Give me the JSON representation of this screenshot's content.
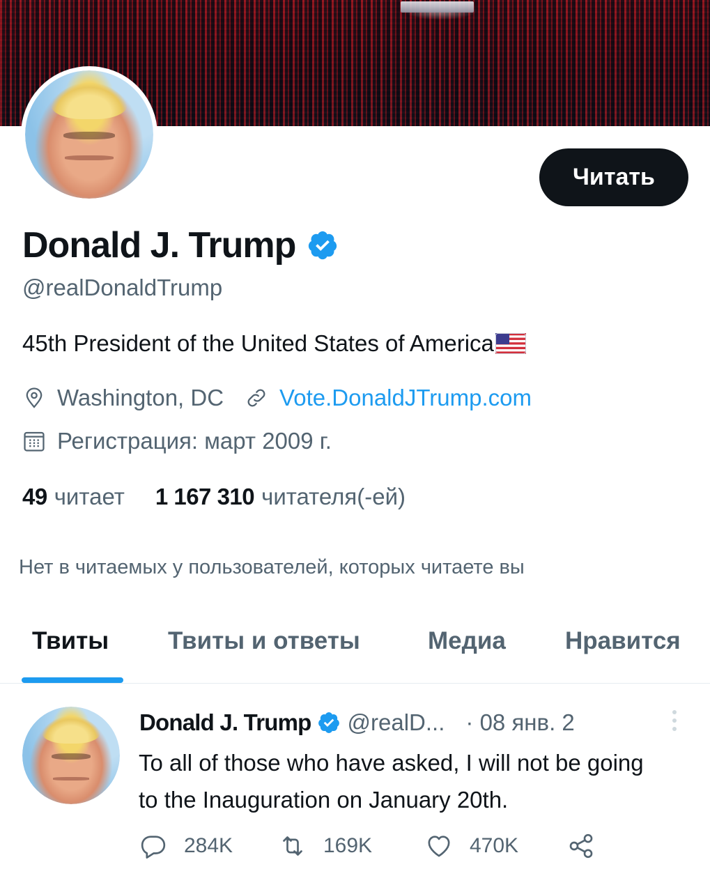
{
  "profile": {
    "follow_label": "Читать",
    "name": "Donald J. Trump",
    "handle": "@realDonaldTrump",
    "bio": "45th President of the United States of America",
    "location": "Washington, DC",
    "website": "Vote.DonaldJTrump.com",
    "joined": "Регистрация: март 2009 г.",
    "following_count": "49",
    "following_label": "читает",
    "followers_count": "1 167 310",
    "followers_label": "читателя(-ей)",
    "followed_by_note": "Нет в читаемых у пользователей, которых читаете вы",
    "verified_color": "#1d9bf0"
  },
  "tabs": [
    {
      "label": "Твиты",
      "active": true
    },
    {
      "label": "Твиты и ответы",
      "active": false
    },
    {
      "label": "Медиа",
      "active": false
    },
    {
      "label": "Нравится",
      "active": false
    }
  ],
  "tweet": {
    "author_name": "Donald J. Trump",
    "author_handle": "@realD...",
    "date": "· 08 янв. 2",
    "text": "To all of those who have asked, I will not be going to the Inauguration on January 20th.",
    "replies": "284K",
    "retweets": "169K",
    "likes": "470K"
  },
  "icons": [
    "verified-badge-icon",
    "us-flag-icon",
    "location-pin-icon",
    "link-icon",
    "calendar-icon",
    "more-vertical-icon",
    "reply-icon",
    "retweet-icon",
    "like-icon",
    "share-icon"
  ],
  "colors": {
    "accent": "#1d9bf0",
    "text": "#0f1419",
    "secondary": "#536471",
    "button": "#0f1419"
  }
}
